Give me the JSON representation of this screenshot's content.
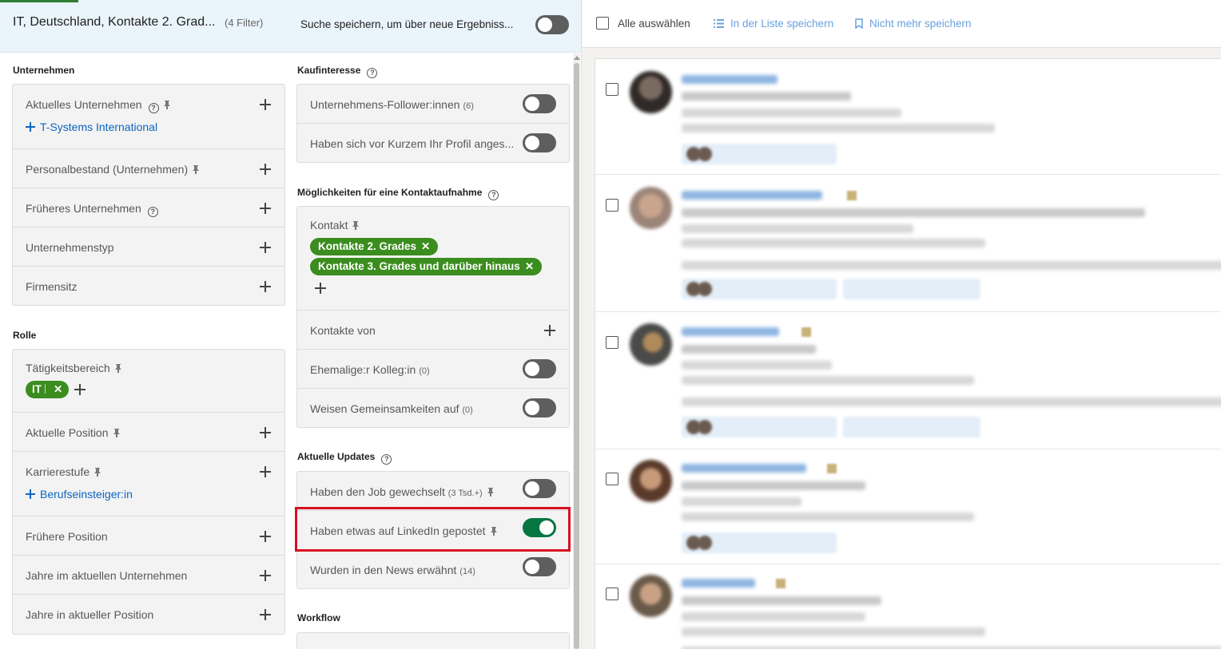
{
  "header": {
    "title": "IT, Deutschland, Kontakte 2. Grad...",
    "filter_count": "(4 Filter)",
    "save_search_label": "Suche speichern, um über neue Ergebniss..."
  },
  "left_column": {
    "unternehmen": {
      "label": "Unternehmen",
      "rows": {
        "aktuelles": "Aktuelles Unternehmen",
        "aktuelles_value": "T-Systems International",
        "personal": "Personalbestand (Unternehmen)",
        "frueheres": "Früheres Unternehmen",
        "typ": "Unternehmenstyp",
        "sitz": "Firmensitz"
      }
    },
    "rolle": {
      "label": "Rolle",
      "rows": {
        "taetigkeit": "Tätigkeitsbereich",
        "taetigkeit_chip": "IT",
        "aktuelle_position": "Aktuelle Position",
        "karriere": "Karrierestufe",
        "karriere_value": "Berufseinsteiger:in",
        "fruehere_position": "Frühere Position",
        "jahre_unternehmen": "Jahre im aktuellen Unternehmen",
        "jahre_position": "Jahre in aktueller Position"
      }
    }
  },
  "right_column": {
    "kaufinteresse": {
      "label": "Kaufinteresse",
      "follower": "Unternehmens-Follower:innen",
      "follower_count": "(6)",
      "profil": "Haben sich vor Kurzem Ihr Profil anges..."
    },
    "kontakt": {
      "label": "Möglichkeiten für eine Kontaktaufnahme",
      "kontakt_label": "Kontakt",
      "chip_1": "Kontakte 2. Grades",
      "chip_2": "Kontakte 3. Grades und darüber hinaus",
      "kontakte_von": "Kontakte von",
      "ehemalige": "Ehemalige:r Kolleg:in",
      "ehemalige_count": "(0)",
      "gemeinsam": "Weisen Gemeinsamkeiten auf",
      "gemeinsam_count": "(0)"
    },
    "updates": {
      "label": "Aktuelle Updates",
      "job": "Haben den Job gewechselt",
      "job_count": "(3 Tsd.+)",
      "gepostet": "Haben etwas auf LinkedIn gepostet",
      "news": "Wurden in den News erwähnt",
      "news_count": "(14)"
    },
    "workflow": {
      "label": "Workflow"
    }
  },
  "toolbar": {
    "select_all": "Alle auswählen",
    "save_list": "In der Liste speichern",
    "unsave": "Nicht mehr speichern"
  },
  "toggles": {
    "save_search": false,
    "follower": false,
    "profil": false,
    "ehemalige": false,
    "gemeinsam": false,
    "job": false,
    "gepostet": true,
    "news": false
  },
  "colors": {
    "accent_green": "#057642",
    "chip_green": "#3a8d1e",
    "link_blue": "#0a66c2",
    "highlight_red": "#d90f1e"
  }
}
